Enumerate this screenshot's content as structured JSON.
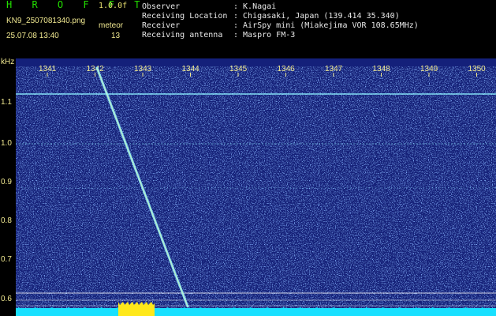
{
  "app": {
    "name": "H R O F F T",
    "version": "1.0.0f",
    "mode": "meteor"
  },
  "capture": {
    "filename": "KN9_2507081340.png",
    "datetime": "25.07.08 13:40",
    "count": "13"
  },
  "meta": [
    {
      "label": "Observer",
      "value": ": K.Nagai"
    },
    {
      "label": "Receiving Location",
      "value": ": Chigasaki, Japan (139.414 35.340)"
    },
    {
      "label": "Receiver",
      "value": ": AirSpy mini (Miakejima VOR 108.65MHz)"
    },
    {
      "label": "Receiving antenna",
      "value": ": Maspro FM-3"
    }
  ],
  "axis": {
    "unit": "kHz",
    "x_ticks": [
      "1341",
      "1342",
      "1343",
      "1344",
      "1345",
      "1346",
      "1347",
      "1348",
      "1349",
      "1350"
    ],
    "y_ticks": [
      "1.1",
      "1.0",
      "0.9",
      "0.8",
      "0.7",
      "0.6"
    ]
  },
  "colors": {
    "background": "#000000",
    "waterfall": "#14207a",
    "noise_bright": "#3a66ff",
    "trace": "#8cf0ff",
    "signal_bar": "#18e0ff",
    "peak": "#ffe81a",
    "labels": "#f0e890",
    "title": "#22e000"
  }
}
